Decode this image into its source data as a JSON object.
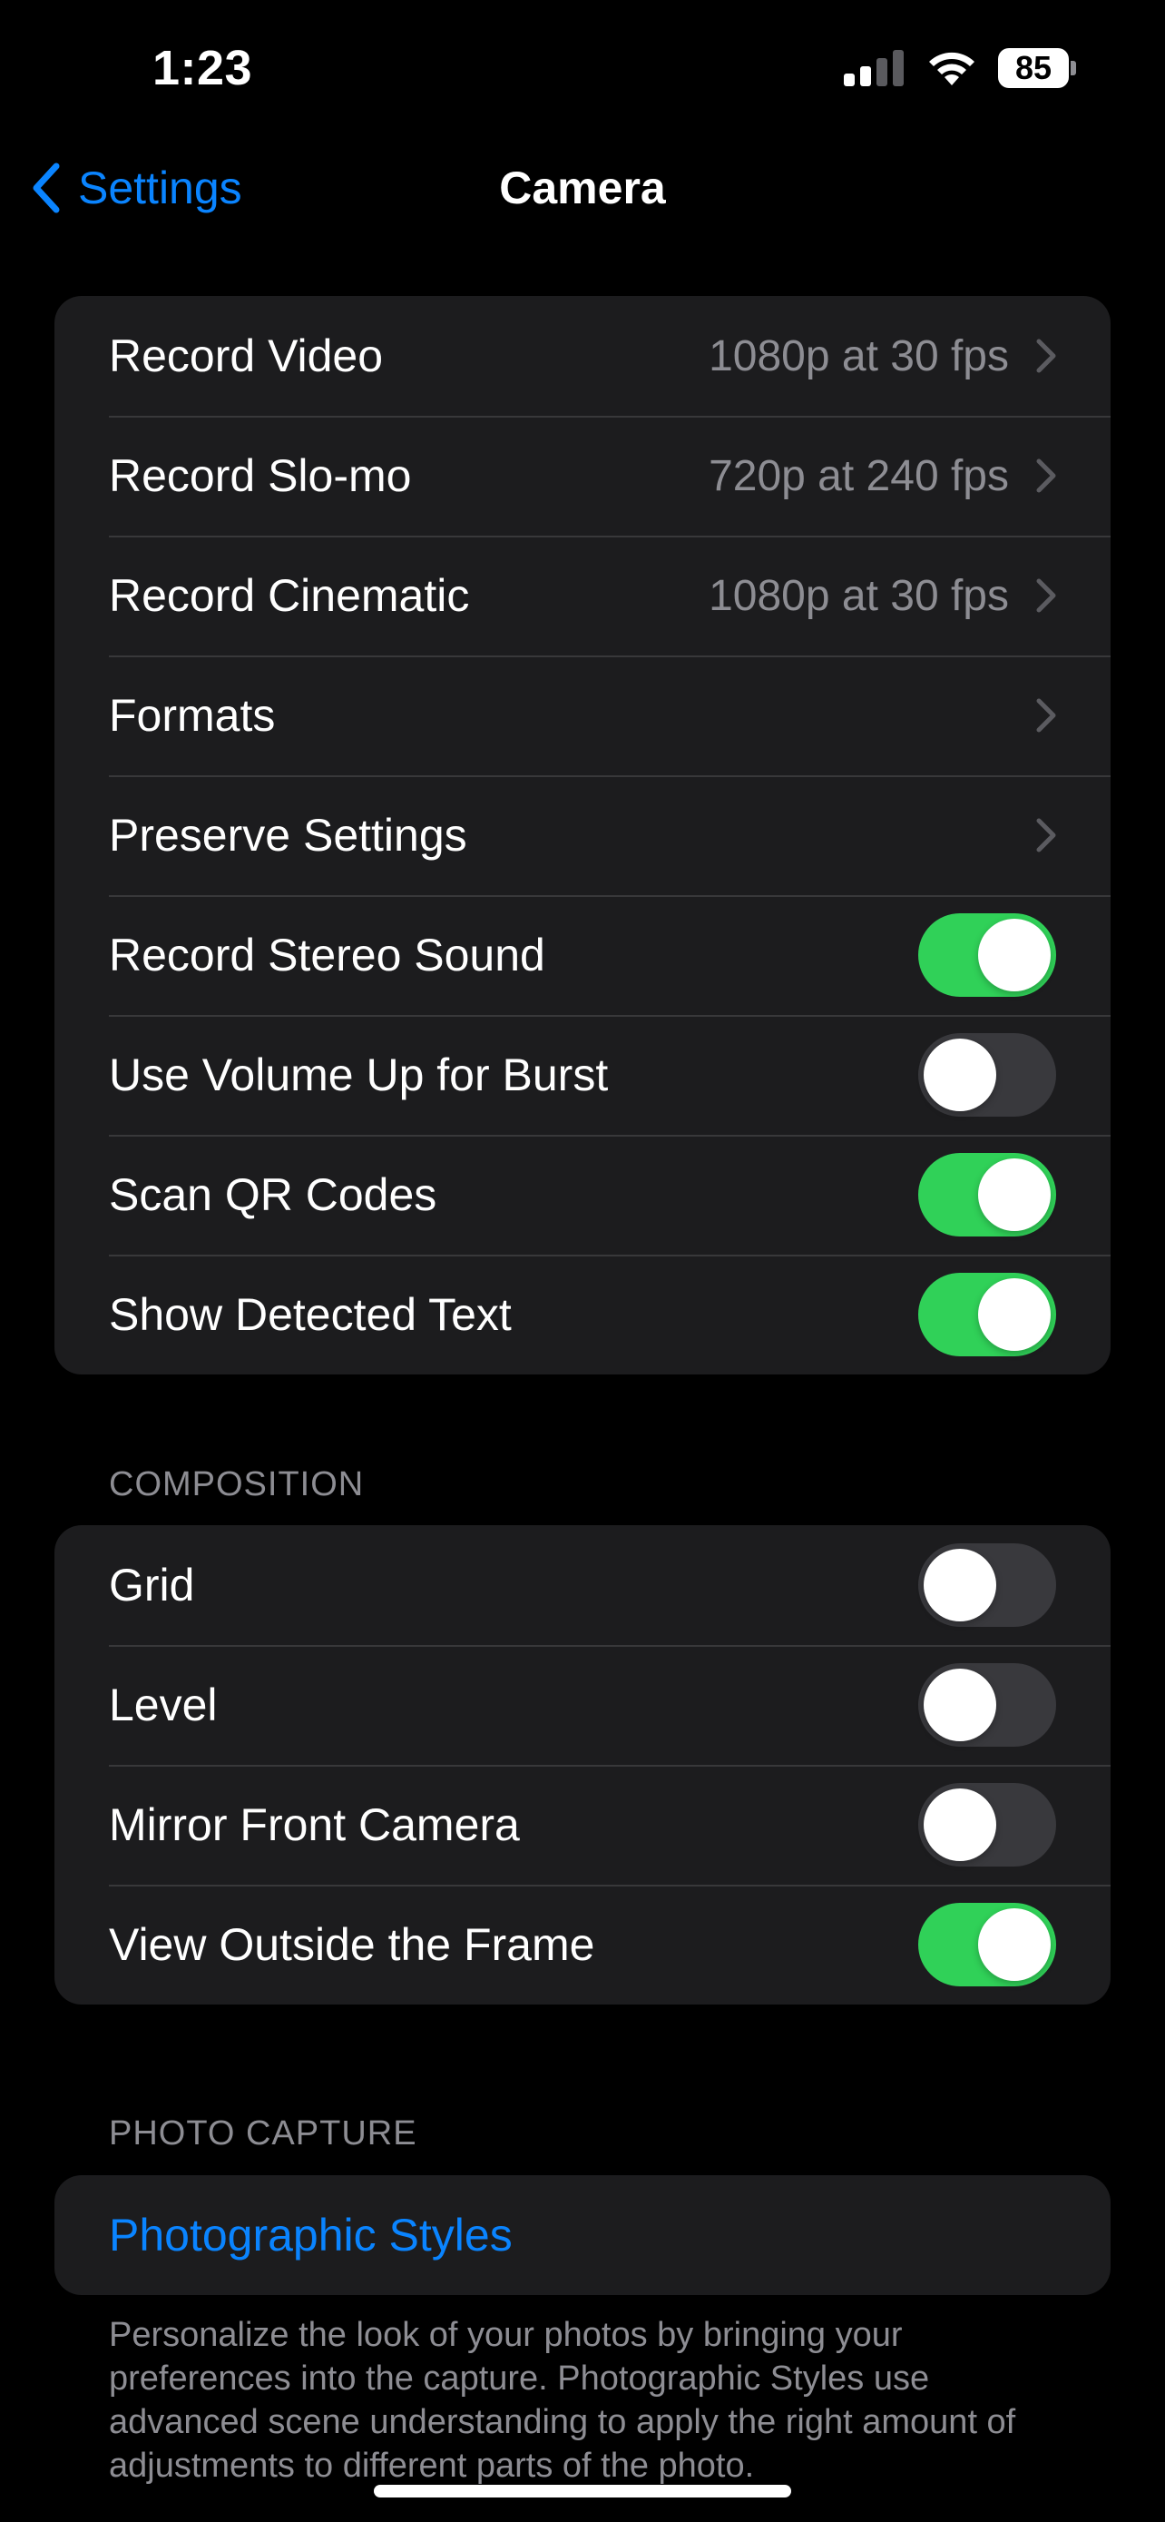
{
  "status_bar": {
    "time": "1:23",
    "battery": "85",
    "icons": [
      "signal-icon",
      "wifi-icon",
      "battery-icon"
    ]
  },
  "nav": {
    "back_label": "Settings",
    "title": "Camera"
  },
  "colors": {
    "accent": "#0a84ff",
    "toggle_on": "#30d158",
    "toggle_off": "#39393d",
    "group_bg": "#1c1c1e"
  },
  "main_group": {
    "rows": [
      {
        "label": "Record Video",
        "value": "1080p at 30 fps"
      },
      {
        "label": "Record Slo-mo",
        "value": "720p at 240 fps"
      },
      {
        "label": "Record Cinematic",
        "value": "1080p at 30 fps"
      },
      {
        "label": "Formats"
      },
      {
        "label": "Preserve Settings"
      },
      {
        "label": "Record Stereo Sound",
        "toggle": true
      },
      {
        "label": "Use Volume Up for Burst",
        "toggle": false
      },
      {
        "label": "Scan QR Codes",
        "toggle": true
      },
      {
        "label": "Show Detected Text",
        "toggle": true
      }
    ]
  },
  "composition": {
    "header": "COMPOSITION",
    "rows": [
      {
        "label": "Grid",
        "toggle": false
      },
      {
        "label": "Level",
        "toggle": false
      },
      {
        "label": "Mirror Front Camera",
        "toggle": false
      },
      {
        "label": "View Outside the Frame",
        "toggle": true
      }
    ]
  },
  "photo_capture": {
    "header": "PHOTO CAPTURE",
    "link_label": "Photographic Styles",
    "footer": "Personalize the look of your photos by bringing your preferences into the capture. Photographic Styles use advanced scene understanding to apply the right amount of adjustments to different parts of the photo."
  }
}
